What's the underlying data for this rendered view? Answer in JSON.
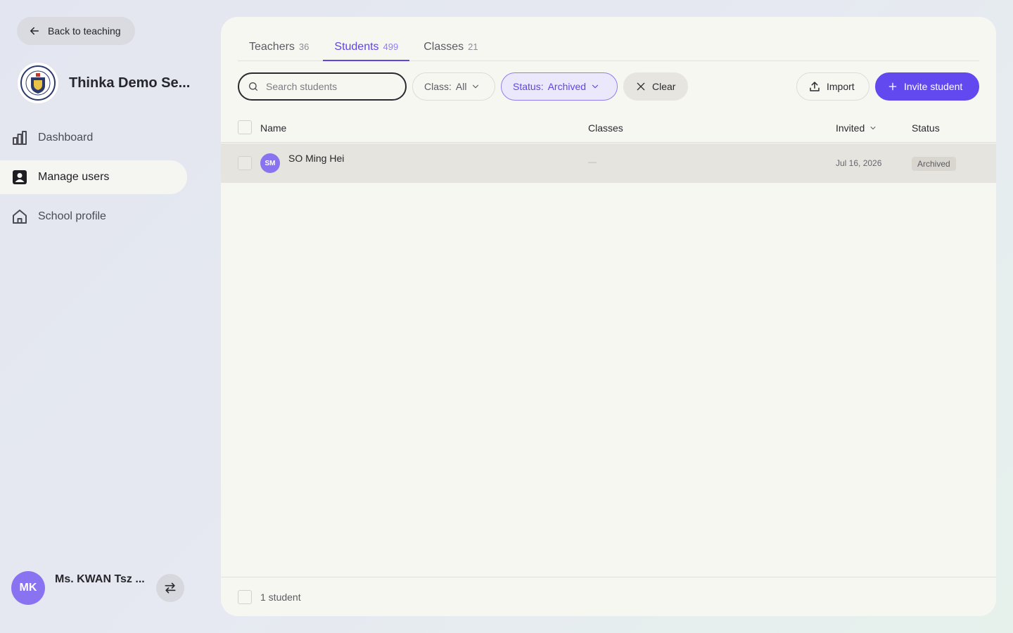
{
  "sidebar": {
    "back_label": "Back to teaching",
    "school_name": "Thinka Demo Se...",
    "nav": [
      {
        "label": "Dashboard"
      },
      {
        "label": "Manage users"
      },
      {
        "label": "School profile"
      }
    ],
    "user": {
      "initials": "MK",
      "name": "Ms. KWAN Tsz ..."
    }
  },
  "tabs": [
    {
      "label": "Teachers",
      "count": "36"
    },
    {
      "label": "Students",
      "count": "499"
    },
    {
      "label": "Classes",
      "count": "21"
    }
  ],
  "toolbar": {
    "search_placeholder": "Search students",
    "class_filter_label": "Class:",
    "class_filter_value": "All",
    "status_filter_label": "Status:",
    "status_filter_value": "Archived",
    "clear_label": "Clear",
    "import_label": "Import",
    "invite_label": "Invite student"
  },
  "table": {
    "columns": [
      "Name",
      "Classes",
      "Invited",
      "Status"
    ],
    "rows": [
      {
        "initials": "SM",
        "name": "SO Ming Hei",
        "classes": "—",
        "invited": "Jul 16, 2026",
        "status": "Archived"
      }
    ]
  },
  "footer": {
    "count_label": "1 student"
  },
  "colors": {
    "accent": "#6148ef",
    "avatar": "#8a73f0",
    "row_highlight": "#e6e4de"
  }
}
